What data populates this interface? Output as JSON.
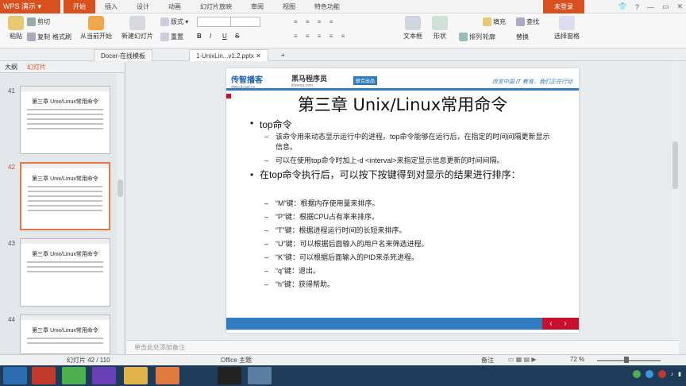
{
  "app": {
    "name": "WPS 演示",
    "login": "未登录"
  },
  "menu": [
    "开始",
    "插入",
    "设计",
    "动画",
    "幻灯片放映",
    "审阅",
    "视图",
    "特色功能"
  ],
  "ribbon": {
    "paste": "粘贴",
    "cut": "剪切",
    "copy": "复制",
    "format_painter": "格式刷",
    "from_current": "从当前开始",
    "new_slide": "新建幻灯片",
    "layout": "版式",
    "reset": "重置",
    "font_bold": "B",
    "font_italic": "I",
    "font_underline": "U",
    "font_strike": "S",
    "textbox": "文本框",
    "shapes": "形状",
    "arrange": "排列",
    "fill": "填充",
    "outline": "轮廓",
    "find": "查找",
    "replace": "替换",
    "select_pane": "选择窗格"
  },
  "tabs": [
    {
      "label": "Docer-在线模板"
    },
    {
      "label": "1-UnixLin...v1.2.pptx"
    }
  ],
  "side": {
    "outline_tab": "大纲",
    "slides_tab": "幻灯片"
  },
  "thumbnails": [
    {
      "num": "41",
      "title": "第三章 Unix/Linux常用命令"
    },
    {
      "num": "42",
      "title": "第三章 Unix/Linux常用命令"
    },
    {
      "num": "43",
      "title": "第三章 Unix/Linux常用命令"
    },
    {
      "num": "44",
      "title": "第三章 Unix/Linux常用命令"
    }
  ],
  "slide": {
    "logo1": "传智播客",
    "logo1_sub": "www.itcast.cn",
    "logo2": "黑马程序员",
    "logo2_sub": "itheima.com",
    "badge": "联合出品",
    "slogan": "改变中国 IT 教育，我们正在行动",
    "title": "第三章 Unix/Linux常用命令",
    "bullet1": "top命令",
    "sub1": "该命令用来动态显示运行中的进程。top命令能够在运行后，在指定的时间间隔更新显示信息。",
    "sub2": "可以在使用top命令时加上-d <interval>来指定显示信息更新的时间间隔。",
    "bullet2": "在top命令执行后，可以按下按键得到对显示的结果进行排序：",
    "keys": [
      "“M”键：根据内存使用量来排序。",
      "“P”键：根据CPU占有率来排序。",
      "“T”键：根据进程运行时间的长短来排序。",
      "“U”键：可以根据后面输入的用户名来筛选进程。",
      "“K”键：可以根据后面输入的PID来杀死进程。",
      "“q”键：退出。",
      "“h”键：获得帮助。"
    ],
    "nav": "‹ ›"
  },
  "notes_placeholder": "单击此处添加备注",
  "status": {
    "slide_count": "幻灯片 42 / 110",
    "theme": "Office 主题",
    "notes": "备注",
    "zoom": "72 %"
  },
  "colors": {
    "accent": "#d9501f",
    "slide_blue": "#2f7cc1",
    "slide_red": "#c8102e"
  }
}
